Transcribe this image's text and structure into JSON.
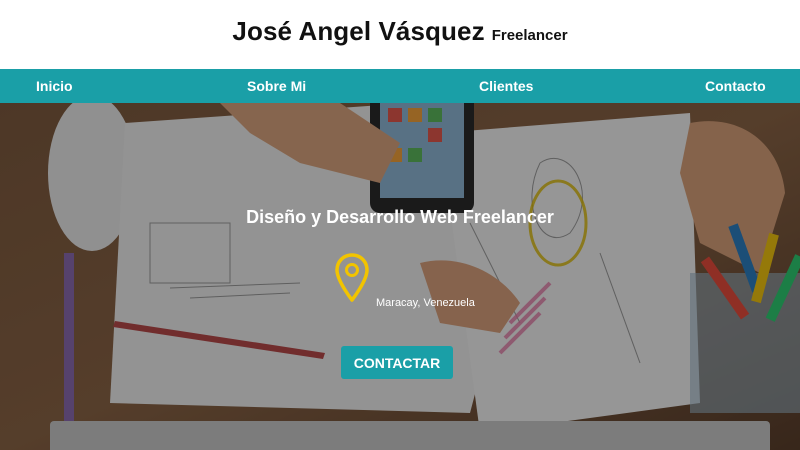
{
  "header": {
    "name": "José Angel Vásquez",
    "role": "Freelancer"
  },
  "nav": {
    "items": [
      {
        "label": "Inicio"
      },
      {
        "label": "Sobre Mi"
      },
      {
        "label": "Clientes"
      },
      {
        "label": "Contacto"
      }
    ]
  },
  "hero": {
    "title": "Diseño y Desarrollo Web Freelancer",
    "location": "Maracay, Venezuela",
    "location_icon": "map-pin-icon",
    "cta_label": "CONTACTAR"
  },
  "colors": {
    "accent": "#1a9fa7",
    "pin": "#f2c400",
    "header_bg": "#ffffff",
    "text_dark": "#111111"
  }
}
